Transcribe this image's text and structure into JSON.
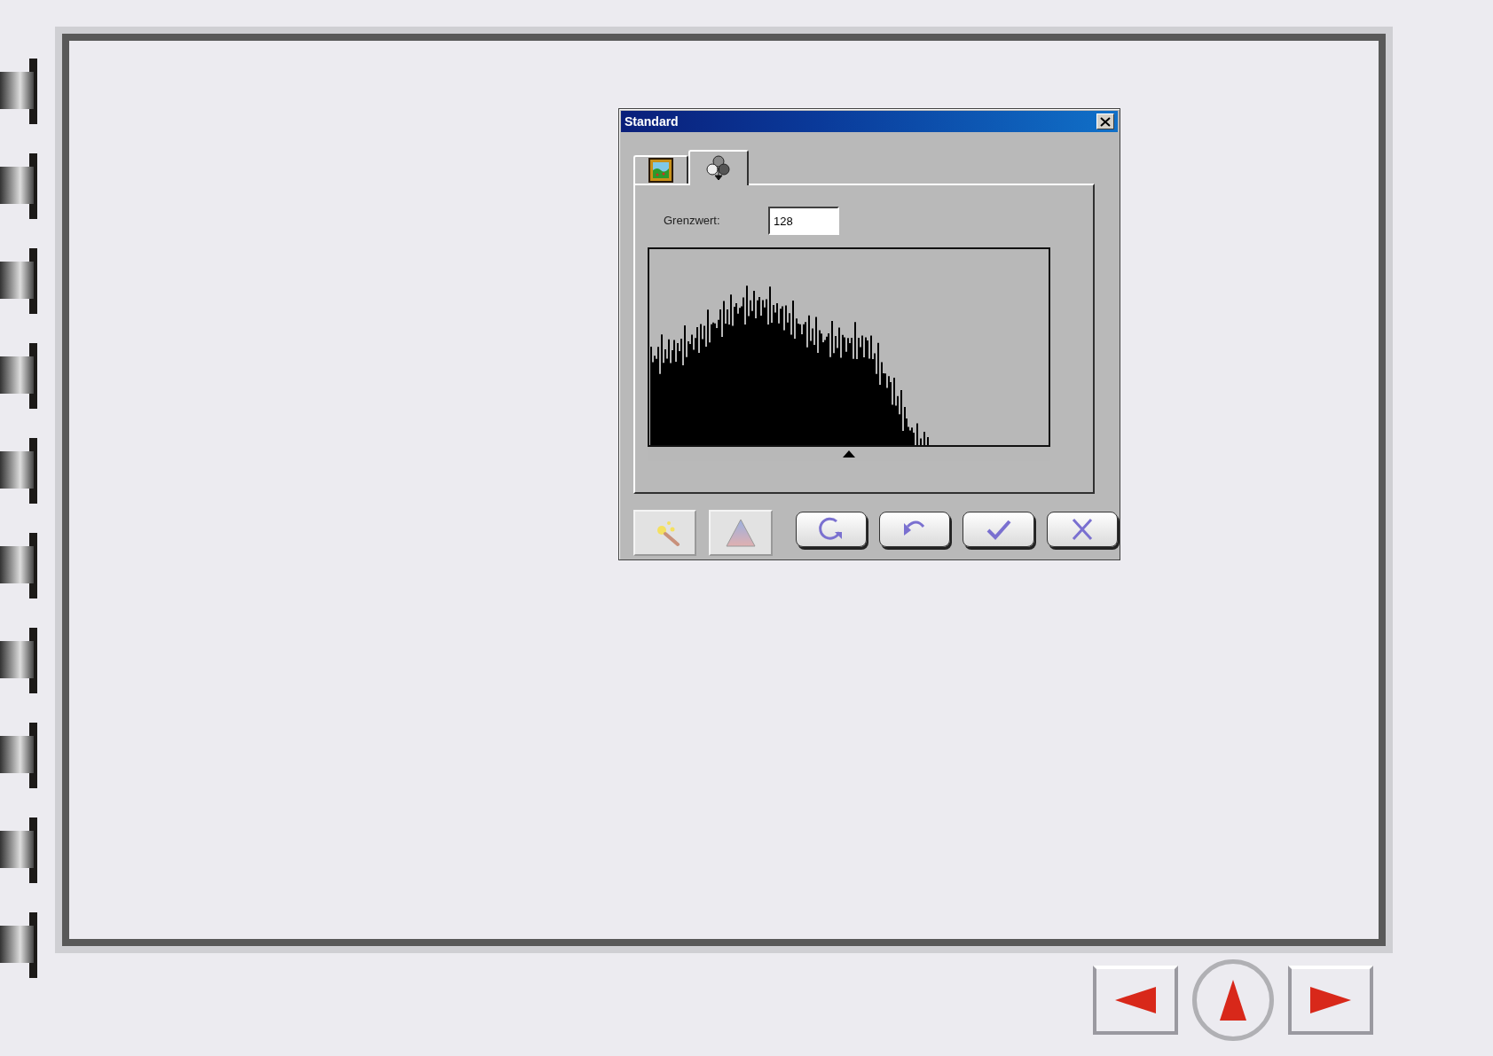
{
  "window": {
    "title": "Standard"
  },
  "tabs": [
    {
      "kind": "image",
      "selected": false
    },
    {
      "kind": "channels",
      "selected": true
    }
  ],
  "threshold": {
    "label": "Grenzwert:",
    "value": "128",
    "level": 0.5
  },
  "buttons": [
    {
      "kind": "wand"
    },
    {
      "kind": "triangle"
    },
    {
      "kind": "reset"
    },
    {
      "kind": "undo"
    },
    {
      "kind": "ok"
    },
    {
      "kind": "cancel"
    }
  ]
}
